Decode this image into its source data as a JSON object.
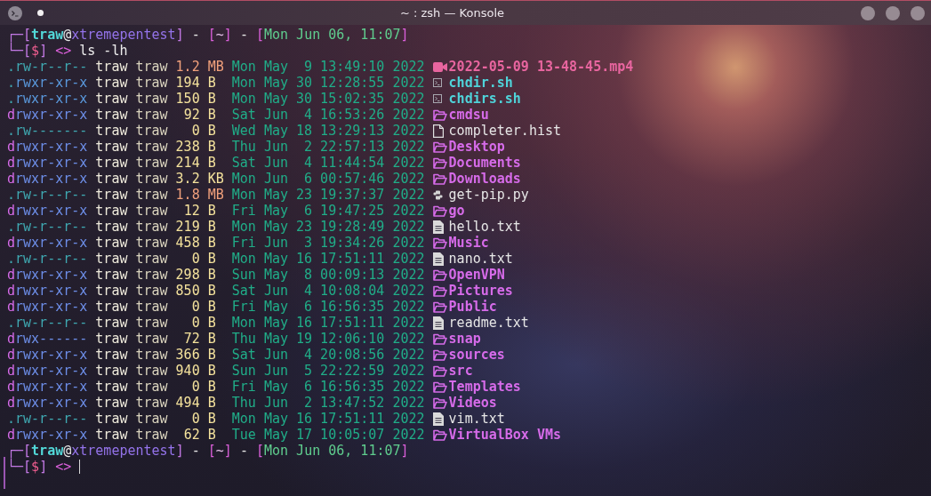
{
  "window": {
    "title": "~ : zsh — Konsole"
  },
  "terminal": {
    "command_prompt": {
      "lines": [
        [
          {
            "text": "┌─[",
            "kind": "frame"
          },
          {
            "text": "traw",
            "kind": "user"
          },
          {
            "text": "@",
            "kind": "at"
          },
          {
            "text": "xtremepentest",
            "kind": "host"
          },
          {
            "text": "]",
            "kind": "frame"
          },
          {
            "text": " - ",
            "kind": "plain"
          },
          {
            "text": "[",
            "kind": "bracket"
          },
          {
            "text": "~",
            "kind": "path"
          },
          {
            "text": "]",
            "kind": "bracket"
          },
          {
            "text": " - ",
            "kind": "plain"
          },
          {
            "text": "[",
            "kind": "bracket"
          },
          {
            "text": "Mon Jun 06, 11:07",
            "kind": "clock"
          },
          {
            "text": "]",
            "kind": "bracket"
          }
        ],
        [
          {
            "text": "└─[",
            "kind": "frame"
          },
          {
            "text": "$",
            "kind": "symbol"
          },
          {
            "text": "] ",
            "kind": "frame"
          },
          {
            "text": "<> ",
            "kind": "marker"
          },
          {
            "text": "ls -lh",
            "kind": "command"
          }
        ]
      ],
      "cursor": false
    },
    "listing": [
      {
        "kind": "video",
        "type_flag": ".",
        "perms": "rw-r--r--",
        "owner": "traw",
        "group": "traw",
        "size": {
          "value": "1.2",
          "unit": "MB",
          "color": "#f2a17c"
        },
        "modified": "Mon May  9 13:49:10 2022",
        "name": "2022-05-09 13-48-45.mp4"
      },
      {
        "kind": "script",
        "type_flag": ".",
        "perms": "rwxr-xr-x",
        "owner": "traw",
        "group": "traw",
        "size": {
          "value": "194",
          "unit": "B",
          "color": "#f4e29c"
        },
        "modified": "Mon May 30 12:28:55 2022",
        "name": "chdir.sh"
      },
      {
        "kind": "script",
        "type_flag": ".",
        "perms": "rwxr-xr-x",
        "owner": "traw",
        "group": "traw",
        "size": {
          "value": "150",
          "unit": "B",
          "color": "#f4e29c"
        },
        "modified": "Mon May 30 15:02:35 2022",
        "name": "chdirs.sh"
      },
      {
        "kind": "folder",
        "type_flag": "d",
        "perms": "rwxr-xr-x",
        "owner": "traw",
        "group": "traw",
        "size": {
          "value": "92",
          "unit": "B",
          "color": "#f4e29c"
        },
        "modified": "Sat Jun  4 16:53:26 2022",
        "name": "cmdsu"
      },
      {
        "kind": "file",
        "type_flag": ".",
        "perms": "rw-------",
        "owner": "traw",
        "group": "traw",
        "size": {
          "value": "0",
          "unit": "B",
          "color": "#f4e29c"
        },
        "modified": "Wed May 18 13:29:13 2022",
        "name": "completer.hist"
      },
      {
        "kind": "folder",
        "type_flag": "d",
        "perms": "rwxr-xr-x",
        "owner": "traw",
        "group": "traw",
        "size": {
          "value": "238",
          "unit": "B",
          "color": "#f4e29c"
        },
        "modified": "Thu Jun  2 22:57:13 2022",
        "name": "Desktop"
      },
      {
        "kind": "folder",
        "type_flag": "d",
        "perms": "rwxr-xr-x",
        "owner": "traw",
        "group": "traw",
        "size": {
          "value": "214",
          "unit": "B",
          "color": "#f4e29c"
        },
        "modified": "Sat Jun  4 11:44:54 2022",
        "name": "Documents"
      },
      {
        "kind": "folder",
        "type_flag": "d",
        "perms": "rwxr-xr-x",
        "owner": "traw",
        "group": "traw",
        "size": {
          "value": "3.2",
          "unit": "KB",
          "color": "#f4e29c"
        },
        "modified": "Mon Jun  6 00:57:46 2022",
        "name": "Downloads"
      },
      {
        "kind": "python",
        "type_flag": ".",
        "perms": "rw-r--r--",
        "owner": "traw",
        "group": "traw",
        "size": {
          "value": "1.8",
          "unit": "MB",
          "color": "#f2a17c"
        },
        "modified": "Mon May 23 19:37:37 2022",
        "name": "get-pip.py"
      },
      {
        "kind": "folder",
        "type_flag": "d",
        "perms": "rwxr-xr-x",
        "owner": "traw",
        "group": "traw",
        "size": {
          "value": "12",
          "unit": "B",
          "color": "#f4e29c"
        },
        "modified": "Fri May  6 19:47:25 2022",
        "name": "go"
      },
      {
        "kind": "text",
        "type_flag": ".",
        "perms": "rw-r--r--",
        "owner": "traw",
        "group": "traw",
        "size": {
          "value": "219",
          "unit": "B",
          "color": "#f4e29c"
        },
        "modified": "Mon May 23 19:28:49 2022",
        "name": "hello.txt"
      },
      {
        "kind": "folder",
        "type_flag": "d",
        "perms": "rwxr-xr-x",
        "owner": "traw",
        "group": "traw",
        "size": {
          "value": "458",
          "unit": "B",
          "color": "#f4e29c"
        },
        "modified": "Fri Jun  3 19:34:26 2022",
        "name": "Music"
      },
      {
        "kind": "text",
        "type_flag": ".",
        "perms": "rw-r--r--",
        "owner": "traw",
        "group": "traw",
        "size": {
          "value": "0",
          "unit": "B",
          "color": "#f4e29c"
        },
        "modified": "Mon May 16 17:51:11 2022",
        "name": "nano.txt"
      },
      {
        "kind": "folder",
        "type_flag": "d",
        "perms": "rwxr-xr-x",
        "owner": "traw",
        "group": "traw",
        "size": {
          "value": "298",
          "unit": "B",
          "color": "#f4e29c"
        },
        "modified": "Sun May  8 00:09:13 2022",
        "name": "OpenVPN"
      },
      {
        "kind": "folder",
        "type_flag": "d",
        "perms": "rwxr-xr-x",
        "owner": "traw",
        "group": "traw",
        "size": {
          "value": "850",
          "unit": "B",
          "color": "#f4e29c"
        },
        "modified": "Sat Jun  4 10:08:04 2022",
        "name": "Pictures"
      },
      {
        "kind": "folder",
        "type_flag": "d",
        "perms": "rwxr-xr-x",
        "owner": "traw",
        "group": "traw",
        "size": {
          "value": "0",
          "unit": "B",
          "color": "#f4e29c"
        },
        "modified": "Fri May  6 16:56:35 2022",
        "name": "Public"
      },
      {
        "kind": "text",
        "type_flag": ".",
        "perms": "rw-r--r--",
        "owner": "traw",
        "group": "traw",
        "size": {
          "value": "0",
          "unit": "B",
          "color": "#f4e29c"
        },
        "modified": "Mon May 16 17:51:11 2022",
        "name": "readme.txt"
      },
      {
        "kind": "folder",
        "type_flag": "d",
        "perms": "rwx------",
        "owner": "traw",
        "group": "traw",
        "size": {
          "value": "72",
          "unit": "B",
          "color": "#f4e29c"
        },
        "modified": "Thu May 19 12:06:10 2022",
        "name": "snap"
      },
      {
        "kind": "folder",
        "type_flag": "d",
        "perms": "rwxr-xr-x",
        "owner": "traw",
        "group": "traw",
        "size": {
          "value": "366",
          "unit": "B",
          "color": "#f4e29c"
        },
        "modified": "Sat Jun  4 20:08:56 2022",
        "name": "sources"
      },
      {
        "kind": "folder",
        "type_flag": "d",
        "perms": "rwxr-xr-x",
        "owner": "traw",
        "group": "traw",
        "size": {
          "value": "940",
          "unit": "B",
          "color": "#f4e29c"
        },
        "modified": "Sun Jun  5 22:22:59 2022",
        "name": "src"
      },
      {
        "kind": "folder",
        "type_flag": "d",
        "perms": "rwxr-xr-x",
        "owner": "traw",
        "group": "traw",
        "size": {
          "value": "0",
          "unit": "B",
          "color": "#f4e29c"
        },
        "modified": "Fri May  6 16:56:35 2022",
        "name": "Templates"
      },
      {
        "kind": "folder",
        "type_flag": "d",
        "perms": "rwxr-xr-x",
        "owner": "traw",
        "group": "traw",
        "size": {
          "value": "494",
          "unit": "B",
          "color": "#f4e29c"
        },
        "modified": "Thu Jun  2 13:47:52 2022",
        "name": "Videos"
      },
      {
        "kind": "text",
        "type_flag": ".",
        "perms": "rw-r--r--",
        "owner": "traw",
        "group": "traw",
        "size": {
          "value": "0",
          "unit": "B",
          "color": "#f4e29c"
        },
        "modified": "Mon May 16 17:51:11 2022",
        "name": "vim.txt"
      },
      {
        "kind": "folder",
        "type_flag": "d",
        "perms": "rwxr-xr-x",
        "owner": "traw",
        "group": "traw",
        "size": {
          "value": "62",
          "unit": "B",
          "color": "#f4e29c"
        },
        "modified": "Tue May 17 10:05:07 2022",
        "name": "VirtualBox VMs"
      }
    ],
    "current_prompt": {
      "lines": [
        [
          {
            "text": "┌─[",
            "kind": "frame"
          },
          {
            "text": "traw",
            "kind": "user"
          },
          {
            "text": "@",
            "kind": "at"
          },
          {
            "text": "xtremepentest",
            "kind": "host"
          },
          {
            "text": "]",
            "kind": "frame"
          },
          {
            "text": " - ",
            "kind": "plain"
          },
          {
            "text": "[",
            "kind": "bracket"
          },
          {
            "text": "~",
            "kind": "path"
          },
          {
            "text": "]",
            "kind": "bracket"
          },
          {
            "text": " - ",
            "kind": "plain"
          },
          {
            "text": "[",
            "kind": "bracket"
          },
          {
            "text": "Mon Jun 06, 11:07",
            "kind": "clock"
          },
          {
            "text": "]",
            "kind": "bracket"
          }
        ],
        [
          {
            "text": "└─[",
            "kind": "frame"
          },
          {
            "text": "$",
            "kind": "symbol"
          },
          {
            "text": "] ",
            "kind": "frame"
          },
          {
            "text": "<> ",
            "kind": "marker"
          }
        ]
      ],
      "cursor": true
    }
  }
}
